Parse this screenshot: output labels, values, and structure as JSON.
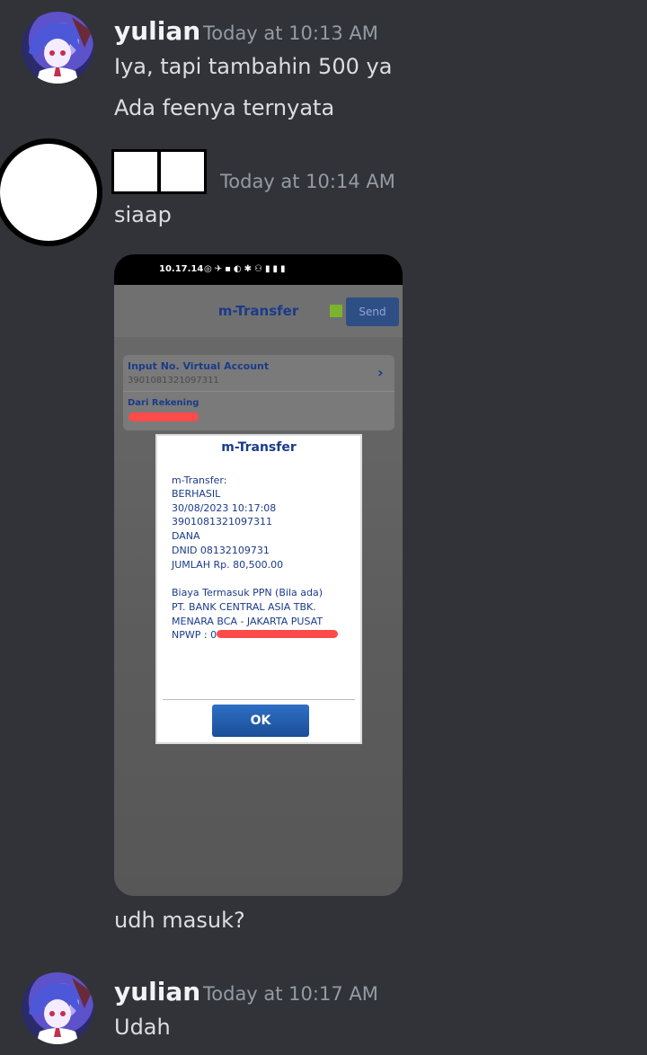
{
  "messages": [
    {
      "username": "yulian",
      "timestamp": "Today at 10:13 AM",
      "lines": [
        "Iya, tapi tambahin 500 ya",
        "Ada feenya ternyata"
      ]
    },
    {
      "username": "",
      "timestamp": "Today at 10:14 AM",
      "lines": [
        "siaap",
        "udh masuk?"
      ],
      "attachment": {
        "statusbar": "10.17.14",
        "app_title": "m-Transfer",
        "send_label": "Send",
        "va_label": "Input No. Virtual Account",
        "va_number": "3901081321097311",
        "rekening_label": "Dari Rekening",
        "chevron": "›",
        "dialog": {
          "title": "m-Transfer",
          "lines": [
            "m-Transfer:",
            "BERHASIL",
            "30/08/2023 10:17:08",
            "3901081321097311",
            "DANA",
            "DNID 08132109731",
            "JUMLAH Rp. 80,500.00",
            "Biaya Termasuk PPN (Bila ada)",
            "PT. BANK CENTRAL ASIA TBK.",
            "MENARA BCA - JAKARTA PUSAT",
            "NPWP : 0"
          ],
          "ok_label": "OK"
        }
      }
    },
    {
      "username": "yulian",
      "timestamp": "Today at 10:17 AM",
      "lines": [
        "Udah"
      ]
    }
  ],
  "colors": {
    "background": "#313338",
    "username": "#f2f3f5",
    "timestamp": "#949ba4",
    "message": "#dbdee1"
  },
  "icons": [
    "anime-avatar",
    "blank-avatar",
    "chevron-right-icon"
  ]
}
